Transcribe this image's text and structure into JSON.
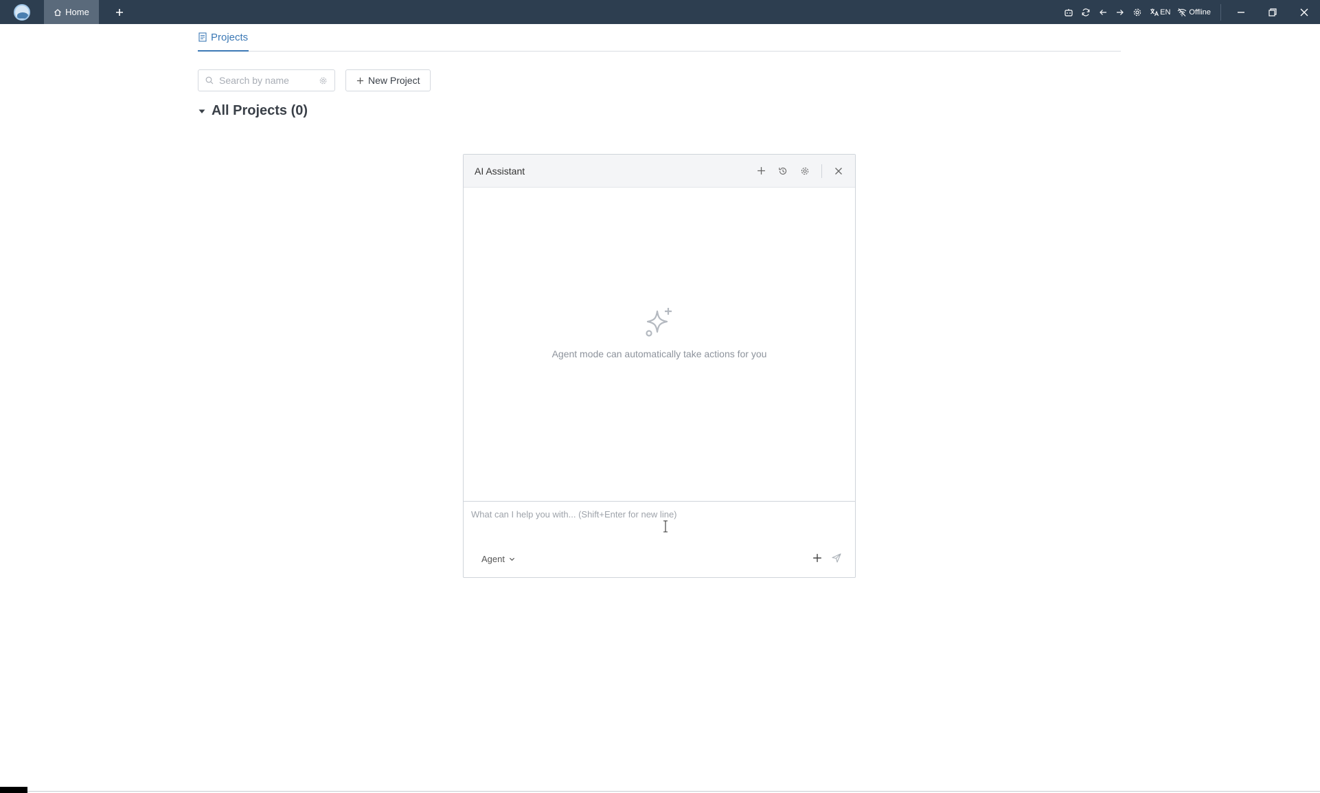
{
  "titlebar": {
    "home_tab_label": "Home",
    "language_label": "EN",
    "status_label": "Offline",
    "background_color": "#2d3e50",
    "active_tab_color": "#5a6a7b",
    "icons": [
      "app-logo",
      "home-icon",
      "plus-icon",
      "robot-icon",
      "refresh-icon",
      "arrow-left-icon",
      "arrow-right-icon",
      "gear-icon",
      "translate-icon",
      "wifi-off-icon",
      "minimize-icon",
      "restore-icon",
      "close-icon"
    ]
  },
  "projects": {
    "tab_label": "Projects",
    "search_placeholder": "Search by name",
    "new_project_label": "New Project",
    "group_title": "All Projects (0)",
    "accent_color": "#3b78b5"
  },
  "ai_assistant": {
    "title": "AI Assistant",
    "empty_message": "Agent mode can automatically take actions for you",
    "input_placeholder": "What can I help you with... (Shift+Enter for new line)",
    "mode_label": "Agent",
    "header_icons": [
      "plus-icon",
      "history-icon",
      "gear-icon",
      "close-icon"
    ]
  }
}
